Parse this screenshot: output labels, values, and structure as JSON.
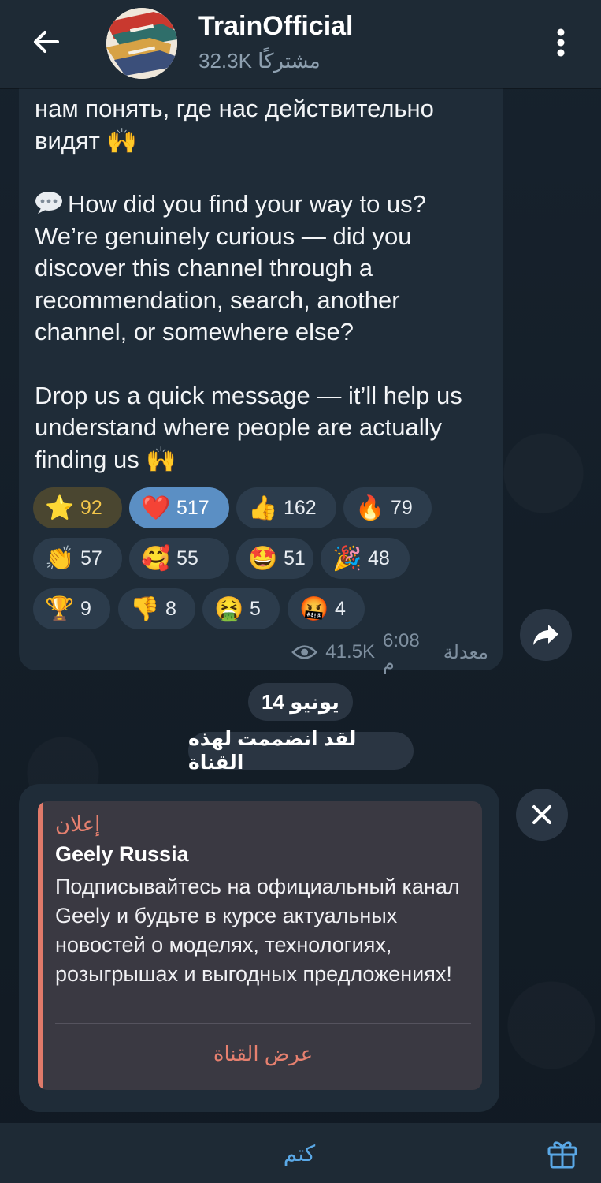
{
  "header": {
    "title": "TrainOfficial",
    "subscribers": "32.3K مشتركًا"
  },
  "message": {
    "partial_top": "нам понять, где нас действительно видят 🙌",
    "paragraph2": "How did you find your way to us? We’re genuinely curious — did you discover this channel through a recommendation, search, another channel, or somewhere else?",
    "paragraph3": "Drop us a quick message — it’ll help us understand where people are actually finding us 🙌",
    "meta_edited": "معدلة",
    "meta_time": "6:08 م",
    "meta_views": "41.5K",
    "reactions": [
      {
        "emoji": "⭐",
        "count": "92"
      },
      {
        "emoji": "❤️",
        "count": "517"
      },
      {
        "emoji": "👍",
        "count": "162"
      },
      {
        "emoji": "🔥",
        "count": "79"
      },
      {
        "emoji": "👏",
        "count": "57"
      },
      {
        "emoji": "🥰",
        "count": "55"
      },
      {
        "emoji": "🤩",
        "count": "51"
      },
      {
        "emoji": "🎉",
        "count": "48"
      },
      {
        "emoji": "🏆",
        "count": "9"
      },
      {
        "emoji": "👎",
        "count": "8"
      },
      {
        "emoji": "🤮",
        "count": "5"
      },
      {
        "emoji": "🤬",
        "count": "4"
      }
    ]
  },
  "service": {
    "date": "14 يونيو",
    "joined": "لقد انضممت لهذه القناة"
  },
  "sponsored": {
    "label": "إعلان",
    "title": "Geely Russia",
    "text": "Подписывайтесь на официальный канал Geely и будьте в курсе актуальных новостей о моделях, технологиях, розыгрышах и выгодных предложениях!",
    "button": "عرض القناة"
  },
  "bottom": {
    "mute": "كتم"
  },
  "colors": {
    "accent": "#5aa8e6",
    "ad_accent": "#e6806f",
    "chosen_reaction": "#5b8fc4"
  }
}
